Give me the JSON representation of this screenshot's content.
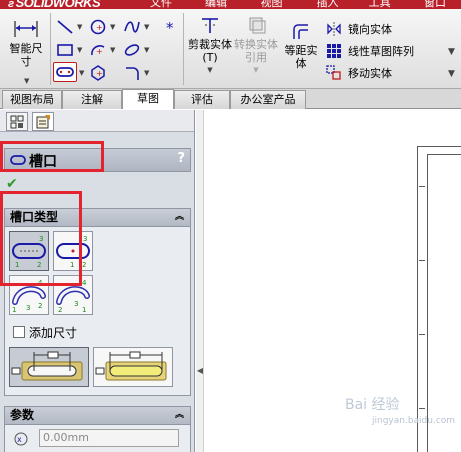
{
  "app": {
    "logo": "SOLIDWORKS"
  },
  "menu": [
    "文件(F)",
    "编辑(E)",
    "视图(V)",
    "插入(I)",
    "工具(T)",
    "窗口(W)"
  ],
  "toolbar": {
    "smart_dim_label": "智能尺寸",
    "trim_label": "剪裁实体(T)",
    "convert_label": "转换实体引用",
    "offset_label": "等距实体",
    "mirror_label": "镜向实体",
    "linear_pattern_label": "线性草图阵列",
    "move_label": "移动实体"
  },
  "tabs": [
    "视图布局",
    "注解",
    "草图",
    "评估",
    "办公室产品"
  ],
  "active_tab": "草图",
  "property_manager": {
    "title": "槽口",
    "help": "?",
    "slot_type_group": "槽口类型",
    "add_dimensions_label": "添加尺寸",
    "parameters_group": "参数",
    "param_value": "0.00mm"
  },
  "slot_type_digits": {
    "straight": [
      "3",
      "1",
      "2"
    ],
    "centerpoint_straight": [
      "3",
      "1",
      "2"
    ],
    "three_point_arc": [
      "4",
      "1",
      "3",
      "2"
    ],
    "centerpoint_arc": [
      "4",
      "2",
      "3",
      "1"
    ]
  },
  "watermark": {
    "main": "Bai 经验",
    "sub": "jingyan.baidu.com"
  },
  "colors": {
    "accent_red": "#e3232e",
    "title_red": "#b8202a",
    "slot_blue": "#1a1aa8",
    "slot_green": "#1a8a1a",
    "check_green": "#2e9a2a"
  }
}
